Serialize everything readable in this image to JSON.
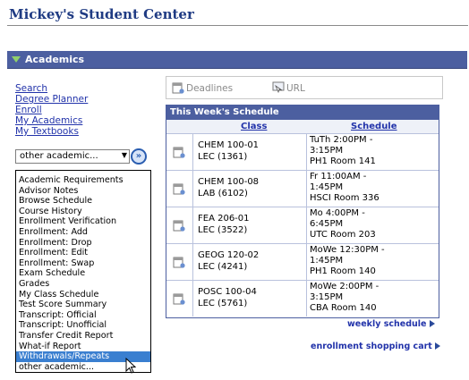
{
  "page_title": "Mickey's Student Center",
  "section_title": "Academics",
  "nav_links": [
    "Search",
    "Degree Planner",
    "Enroll",
    "My Academics",
    "My Textbooks"
  ],
  "select": {
    "value": "other academic...",
    "go_label": "»"
  },
  "dropdown_options": [
    "Academic Requirements",
    "Advisor Notes",
    "Browse Schedule",
    "Course History",
    "Enrollment Verification",
    "Enrollment: Add",
    "Enrollment: Drop",
    "Enrollment: Edit",
    "Enrollment: Swap",
    "Exam Schedule",
    "Grades",
    "My Class Schedule",
    "Test Score Summary",
    "Transcript: Official",
    "Transcript: Unofficial",
    "Transfer Credit Report",
    "What-if Report",
    "Withdrawals/Repeats",
    "other academic..."
  ],
  "dropdown_selected": "Withdrawals/Repeats",
  "toolbar": {
    "deadlines": "Deadlines",
    "url": "URL"
  },
  "schedule": {
    "title": "This Week's Schedule",
    "col_class": "Class",
    "col_schedule": "Schedule",
    "rows": [
      {
        "class": [
          "CHEM 100-01",
          "LEC (1361)"
        ],
        "sched": [
          "TuTh 2:00PM -",
          "3:15PM",
          "PH1  Room 141"
        ]
      },
      {
        "class": [
          "CHEM 100-08",
          "LAB (6102)"
        ],
        "sched": [
          "Fr 11:00AM -",
          "1:45PM",
          "HSCI Room 336"
        ]
      },
      {
        "class": [
          "FEA 206-01",
          "LEC (3522)"
        ],
        "sched": [
          "Mo 4:00PM -",
          "6:45PM",
          "UTC  Room 203"
        ]
      },
      {
        "class": [
          "GEOG 120-02",
          "LEC (4241)"
        ],
        "sched": [
          "MoWe 12:30PM -",
          "1:45PM",
          "PH1  Room 140"
        ]
      },
      {
        "class": [
          "POSC 100-04",
          "LEC (5761)"
        ],
        "sched": [
          "MoWe 2:00PM -",
          "3:15PM",
          "CBA  Room 140"
        ]
      }
    ]
  },
  "weekly_schedule": "weekly schedule",
  "shopping_cart": "enrollment shopping cart",
  "colors": {
    "header_blue": "#4c5fa0",
    "link_blue": "#2233aa",
    "selection_blue": "#3a7fd0"
  }
}
